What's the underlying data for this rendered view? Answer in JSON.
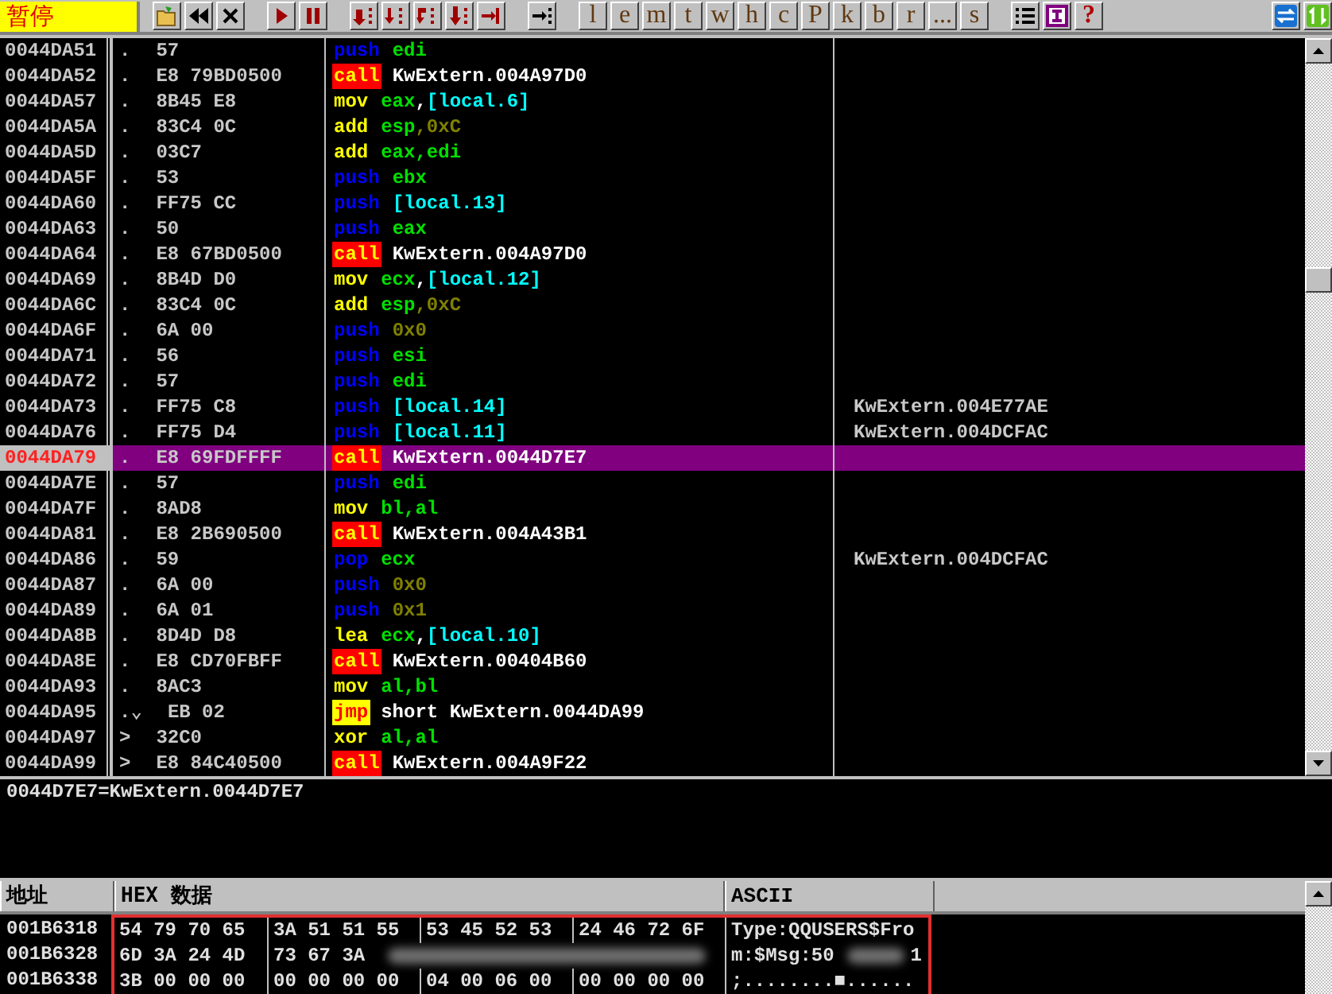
{
  "toolbar": {
    "status": "暂停",
    "letter_buttons": [
      "l",
      "e",
      "m",
      "t",
      "w",
      "h",
      "c",
      "P",
      "k",
      "b",
      "r",
      "...",
      "s"
    ],
    "help_button": "?"
  },
  "disasm": {
    "rows": [
      {
        "address": "0044DA51",
        "marker": ".",
        "hex": "57",
        "mnemonic": "push",
        "kind": "push",
        "ops": [
          {
            "kind": "reg",
            "text": "edi"
          }
        ],
        "selected": false
      },
      {
        "address": "0044DA52",
        "marker": ".",
        "hex": "E8 79BD0500",
        "mnemonic": "call",
        "kind": "call",
        "ops": [
          {
            "kind": "label",
            "text": "KwExtern.004A97D0"
          }
        ],
        "selected": false
      },
      {
        "address": "0044DA57",
        "marker": ".",
        "hex": "8B45 E8",
        "mnemonic": "mov",
        "kind": "op",
        "ops": [
          {
            "kind": "reg",
            "text": "eax"
          },
          {
            "kind": "sep",
            "text": ","
          },
          {
            "kind": "mem",
            "text": "[local.6]"
          }
        ],
        "selected": false
      },
      {
        "address": "0044DA5A",
        "marker": ".",
        "hex": "83C4 0C",
        "mnemonic": "add",
        "kind": "op",
        "ops": [
          {
            "kind": "reg",
            "text": "esp"
          },
          {
            "kind": "imm",
            "text": ",0xC"
          }
        ],
        "selected": false
      },
      {
        "address": "0044DA5D",
        "marker": ".",
        "hex": "03C7",
        "mnemonic": "add",
        "kind": "op",
        "ops": [
          {
            "kind": "reg",
            "text": "eax,edi"
          }
        ],
        "selected": false
      },
      {
        "address": "0044DA5F",
        "marker": ".",
        "hex": "53",
        "mnemonic": "push",
        "kind": "push",
        "ops": [
          {
            "kind": "reg",
            "text": "ebx"
          }
        ],
        "selected": false
      },
      {
        "address": "0044DA60",
        "marker": ".",
        "hex": "FF75 CC",
        "mnemonic": "push",
        "kind": "push",
        "ops": [
          {
            "kind": "mem",
            "text": "[local.13]"
          }
        ],
        "selected": false
      },
      {
        "address": "0044DA63",
        "marker": ".",
        "hex": "50",
        "mnemonic": "push",
        "kind": "push",
        "ops": [
          {
            "kind": "reg",
            "text": "eax"
          }
        ],
        "selected": false
      },
      {
        "address": "0044DA64",
        "marker": ".",
        "hex": "E8 67BD0500",
        "mnemonic": "call",
        "kind": "call",
        "ops": [
          {
            "kind": "label",
            "text": "KwExtern.004A97D0"
          }
        ],
        "selected": false
      },
      {
        "address": "0044DA69",
        "marker": ".",
        "hex": "8B4D D0",
        "mnemonic": "mov",
        "kind": "op",
        "ops": [
          {
            "kind": "reg",
            "text": "ecx"
          },
          {
            "kind": "sep",
            "text": ","
          },
          {
            "kind": "mem",
            "text": "[local.12]"
          }
        ],
        "selected": false
      },
      {
        "address": "0044DA6C",
        "marker": ".",
        "hex": "83C4 0C",
        "mnemonic": "add",
        "kind": "op",
        "ops": [
          {
            "kind": "reg",
            "text": "esp"
          },
          {
            "kind": "imm",
            "text": ",0xC"
          }
        ],
        "selected": false
      },
      {
        "address": "0044DA6F",
        "marker": ".",
        "hex": "6A 00",
        "mnemonic": "push",
        "kind": "push",
        "ops": [
          {
            "kind": "imm",
            "text": "0x0"
          }
        ],
        "selected": false
      },
      {
        "address": "0044DA71",
        "marker": ".",
        "hex": "56",
        "mnemonic": "push",
        "kind": "push",
        "ops": [
          {
            "kind": "reg",
            "text": "esi"
          }
        ],
        "selected": false
      },
      {
        "address": "0044DA72",
        "marker": ".",
        "hex": "57",
        "mnemonic": "push",
        "kind": "push",
        "ops": [
          {
            "kind": "reg",
            "text": "edi"
          }
        ],
        "selected": false
      },
      {
        "address": "0044DA73",
        "marker": ".",
        "hex": "FF75 C8",
        "mnemonic": "push",
        "kind": "push",
        "ops": [
          {
            "kind": "mem",
            "text": "[local.14]"
          }
        ],
        "comment": "KwExtern.004E77AE",
        "selected": false
      },
      {
        "address": "0044DA76",
        "marker": ".",
        "hex": "FF75 D4",
        "mnemonic": "push",
        "kind": "push",
        "ops": [
          {
            "kind": "mem",
            "text": "[local.11]"
          }
        ],
        "comment": "KwExtern.004DCFAC",
        "selected": false
      },
      {
        "address": "0044DA79",
        "marker": ".",
        "hex": "E8 69FDFFFF",
        "mnemonic": "call",
        "kind": "call",
        "ops": [
          {
            "kind": "label",
            "text": "KwExtern.0044D7E7"
          }
        ],
        "selected": true
      },
      {
        "address": "0044DA7E",
        "marker": ".",
        "hex": "57",
        "mnemonic": "push",
        "kind": "push",
        "ops": [
          {
            "kind": "reg",
            "text": "edi"
          }
        ],
        "selected": false
      },
      {
        "address": "0044DA7F",
        "marker": ".",
        "hex": "8AD8",
        "mnemonic": "mov",
        "kind": "op",
        "ops": [
          {
            "kind": "reg",
            "text": "bl,al"
          }
        ],
        "selected": false
      },
      {
        "address": "0044DA81",
        "marker": ".",
        "hex": "E8 2B690500",
        "mnemonic": "call",
        "kind": "call",
        "ops": [
          {
            "kind": "label",
            "text": "KwExtern.004A43B1"
          }
        ],
        "selected": false
      },
      {
        "address": "0044DA86",
        "marker": ".",
        "hex": "59",
        "mnemonic": "pop",
        "kind": "push",
        "ops": [
          {
            "kind": "reg",
            "text": "ecx"
          }
        ],
        "comment": "KwExtern.004DCFAC",
        "selected": false
      },
      {
        "address": "0044DA87",
        "marker": ".",
        "hex": "6A 00",
        "mnemonic": "push",
        "kind": "push",
        "ops": [
          {
            "kind": "imm",
            "text": "0x0"
          }
        ],
        "selected": false
      },
      {
        "address": "0044DA89",
        "marker": ".",
        "hex": "6A 01",
        "mnemonic": "push",
        "kind": "push",
        "ops": [
          {
            "kind": "imm",
            "text": "0x1"
          }
        ],
        "selected": false
      },
      {
        "address": "0044DA8B",
        "marker": ".",
        "hex": "8D4D D8",
        "mnemonic": "lea",
        "kind": "op",
        "ops": [
          {
            "kind": "reg",
            "text": "ecx"
          },
          {
            "kind": "sep",
            "text": ","
          },
          {
            "kind": "mem",
            "text": "[local.10]"
          }
        ],
        "selected": false
      },
      {
        "address": "0044DA8E",
        "marker": ".",
        "hex": "E8 CD70FBFF",
        "mnemonic": "call",
        "kind": "call",
        "ops": [
          {
            "kind": "label",
            "text": "KwExtern.00404B60"
          }
        ],
        "selected": false
      },
      {
        "address": "0044DA93",
        "marker": ".",
        "hex": "8AC3",
        "mnemonic": "mov",
        "kind": "op",
        "ops": [
          {
            "kind": "reg",
            "text": "al,bl"
          }
        ],
        "selected": false
      },
      {
        "address": "0044DA95",
        "marker": ".⌄",
        "hex": "EB 02",
        "mnemonic": "jmp",
        "kind": "jmp",
        "ops": [
          {
            "kind": "label",
            "text": "short KwExtern.0044DA99"
          }
        ],
        "selected": false
      },
      {
        "address": "0044DA97",
        "marker": ">",
        "hex": "32C0",
        "mnemonic": "xor",
        "kind": "op",
        "ops": [
          {
            "kind": "reg",
            "text": "al,al"
          }
        ],
        "selected": false
      },
      {
        "address": "0044DA99",
        "marker": ">",
        "hex": "E8 84C40500",
        "mnemonic": "call",
        "kind": "call",
        "ops": [
          {
            "kind": "label",
            "text": "KwExtern.004A9F22"
          }
        ],
        "selected": false
      }
    ]
  },
  "info": "0044D7E7=KwExtern.0044D7E7",
  "dump": {
    "columns": [
      "地址",
      "HEX 数据",
      "ASCII"
    ],
    "rows": [
      {
        "address": "001B6318",
        "hex": [
          "54 79 70 65",
          "3A 51 51 55",
          "53 45 52 53",
          "24 46 72 6F"
        ],
        "ascii": "Type:QQUSERS$Fro",
        "redacted": false
      },
      {
        "address": "001B6328",
        "hex": [
          "6D 3A 24 4D",
          "73 67 3A"
        ],
        "ascii": "m:$Msg:50",
        "ascii_tail": "1",
        "redacted": true
      },
      {
        "address": "001B6338",
        "hex": [
          "3B 00 00 00",
          "00 00 00 00",
          "04 00 06 00",
          "00 00 00 00"
        ],
        "ascii": ";........■......",
        "redacted": false
      }
    ]
  }
}
